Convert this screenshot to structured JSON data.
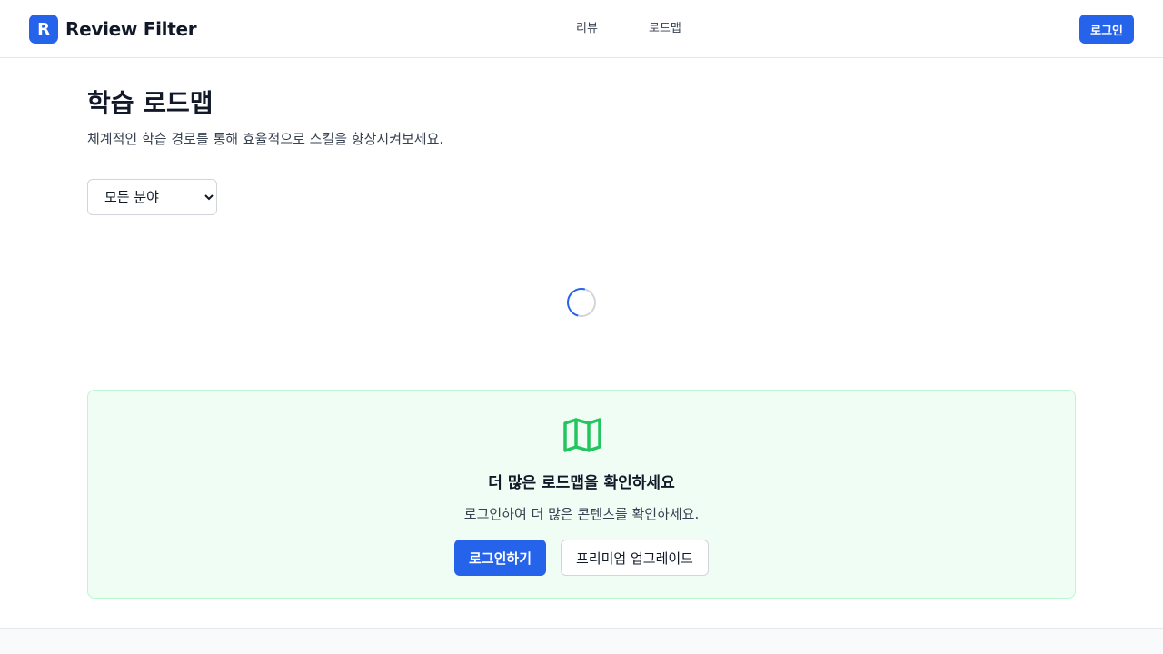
{
  "header": {
    "logo_letter": "R",
    "logo_text": "Review Filter",
    "nav": [
      {
        "label": "리뷰"
      },
      {
        "label": "로드맵"
      }
    ],
    "login_label": "로그인"
  },
  "main": {
    "title": "학습 로드맵",
    "subtitle": "체계적인 학습 경로를 통해 효율적으로 스킬을 향상시켜보세요.",
    "filter": {
      "selected": "모든 분야"
    }
  },
  "cta": {
    "icon": "map-icon",
    "title": "더 많은 로드맵을 확인하세요",
    "description": "로그인하여 더 많은 콘텐츠를 확인하세요.",
    "primary_button": "로그인하기",
    "secondary_button": "프리미엄 업그레이드"
  },
  "colors": {
    "accent": "#2563eb",
    "cta_background": "#f0fdf4",
    "cta_border": "#bbf7d0",
    "map_icon": "#22c55e"
  }
}
